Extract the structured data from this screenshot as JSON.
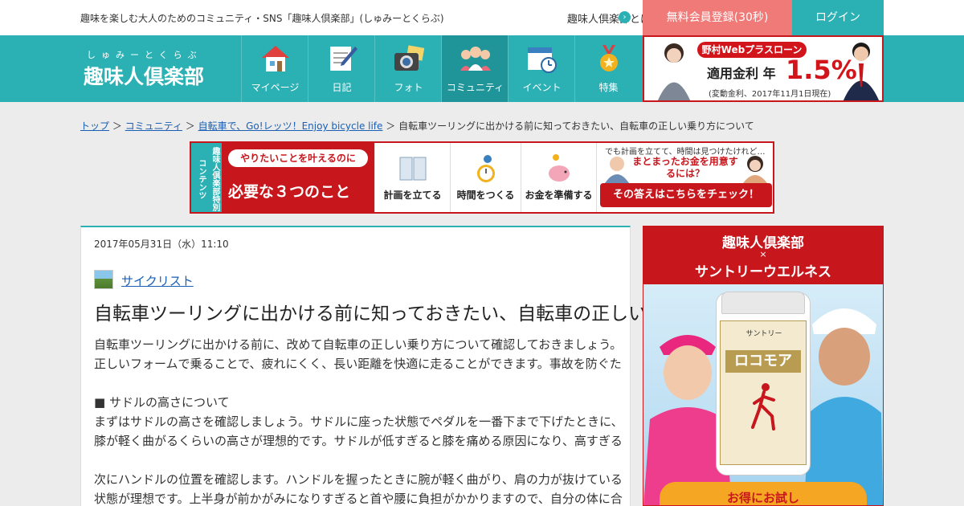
{
  "header": {
    "tagline": "趣味を楽しむ大人のためのコミュニティ・SNS「趣味人倶楽部」(しゅみーとくらぶ)",
    "what_link": "趣味人倶楽部とは",
    "register_label": "無料会員登録(30秒)",
    "login_label": "ログイン"
  },
  "logo": {
    "ruby": "しゅみーとくらぶ",
    "name": "趣味人倶楽部"
  },
  "nav": {
    "items": [
      {
        "label": "マイページ",
        "icon": "house-icon"
      },
      {
        "label": "日記",
        "icon": "notebook-icon"
      },
      {
        "label": "フォト",
        "icon": "camera-icon"
      },
      {
        "label": "コミュニティ",
        "icon": "people-icon"
      },
      {
        "label": "イベント",
        "icon": "calendar-clock-icon"
      },
      {
        "label": "特集",
        "icon": "medal-icon"
      }
    ]
  },
  "top_ad": {
    "head": "野村Webプラスローン",
    "rate_label": "適用金利 年",
    "rate_value": "1.5%",
    "note": "(変動金利、2017年11月1日現在)"
  },
  "breadcrumb": {
    "items": [
      "トップ",
      "コミュニティ",
      "自転車で、Go!レッツ！Enjoy bicycle life"
    ],
    "current": "自転車ツーリングに出かける前に知っておきたい、自転車の正しい乗り方について"
  },
  "promo": {
    "side": "趣味人倶楽部特別コンテンツ",
    "pill": "やりたいことを叶えるのに",
    "big": "必要な３つのこと",
    "cells": [
      {
        "label": "計画を立てる",
        "icon": "book-icon"
      },
      {
        "label": "時間をつくる",
        "icon": "clock-icon"
      },
      {
        "label": "お金を準備する",
        "icon": "piggy-bank-icon"
      }
    ],
    "right_top": "でも計画を立てて、時間は見つけたけれど…",
    "right_mid": "まとまったお金を用意するには？",
    "cta": "その答えはこちらをチェック！"
  },
  "article": {
    "date": "2017年05月31日（水）11:10",
    "author": "サイクリスト",
    "title": "自転車ツーリングに出かける前に知っておきたい、自転車の正しい乗り方について",
    "intro": "自転車ツーリングに出かける前に、改めて自転車の正しい乗り方について確認しておきましょう。正しいフォームで乗ることで、疲れにくく、長い距離を快適に走ることができます。事故を防ぐためにも交通ルールを守って安全に楽しみましょう。",
    "section_title": "■ サドルの高さについて",
    "section_body": "まずはサドルの高さを確認しましょう。サドルに座った状態でペダルを一番下まで下げたときに、膝が軽く曲がるくらいの高さが理想的です。サドルが低すぎると膝を痛める原因になり、高すぎるとペダルをうまく回すことができません。",
    "para3": "次にハンドルの位置を確認します。ハンドルを握ったときに腕が軽く曲がり、肩の力が抜けている状態が理想です。上半身が前かがみになりすぎると首や腰に負担がかかりますので、自分の体に合わせて調整するようにしましょう。"
  },
  "side_ad": {
    "line1": "趣味人倶楽部",
    "x": "×",
    "line2": "サントリーウエルネス",
    "bottle_brand": "サントリー",
    "bottle_name": "ロコモア",
    "ribbon": "お得にお試し"
  }
}
